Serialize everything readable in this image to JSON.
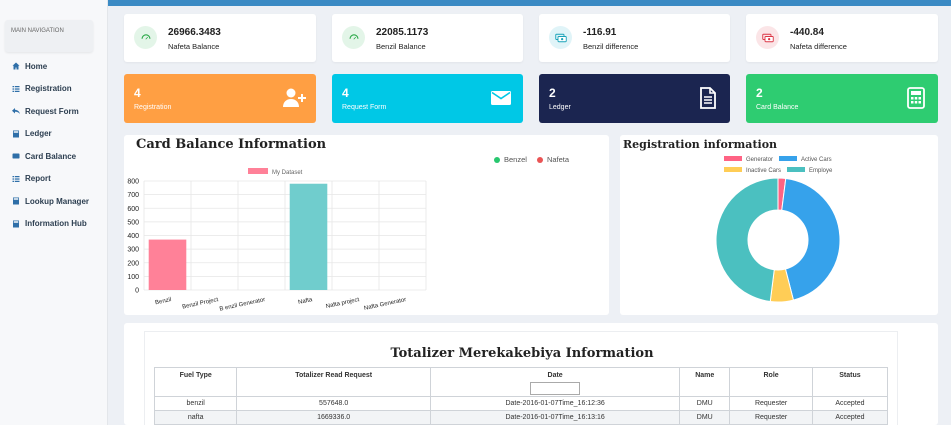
{
  "sidebar": {
    "header": "MAIN NAVIGATION",
    "items": [
      {
        "label": "Home",
        "icon": "home-icon"
      },
      {
        "label": "Registration",
        "icon": "list-icon"
      },
      {
        "label": "Request Form",
        "icon": "reply-icon"
      },
      {
        "label": "Ledger",
        "icon": "book-icon"
      },
      {
        "label": "Card Balance",
        "icon": "card-icon"
      },
      {
        "label": "Report",
        "icon": "list-icon"
      },
      {
        "label": "Lookup Manager",
        "icon": "book-icon"
      },
      {
        "label": "Information Hub",
        "icon": "book-icon"
      }
    ]
  },
  "stats": [
    {
      "value": "26966.3483",
      "label": "Nafeta Balance",
      "icon": "gauge-icon",
      "color": "#28a745"
    },
    {
      "value": "22085.1173",
      "label": "Benzil Balance",
      "icon": "gauge-icon",
      "color": "#28a745"
    },
    {
      "value": "-116.91",
      "label": "Benzil difference",
      "icon": "cash-icon",
      "color": "#17a2b8"
    },
    {
      "value": "-440.84",
      "label": "Nafeta difference",
      "icon": "cash-icon",
      "color": "#dc3545"
    }
  ],
  "cards": [
    {
      "value": "4",
      "label": "Registration",
      "icon": "user-plus-icon",
      "color": "#ff9f43"
    },
    {
      "value": "4",
      "label": "Request Form",
      "icon": "envelope-icon",
      "color": "#00c8e6"
    },
    {
      "value": "2",
      "label": "Ledger",
      "icon": "document-icon",
      "color": "#1b2550"
    },
    {
      "value": "2",
      "label": "Card Balance",
      "icon": "calculator-icon",
      "color": "#2ecc71"
    }
  ],
  "card_balance": {
    "title": "Card Balance Information",
    "legend": [
      {
        "label": "Benzel",
        "color": "#28c76f"
      },
      {
        "label": "Nafeta",
        "color": "#ea5455"
      }
    ]
  },
  "registration": {
    "title": "Registration information"
  },
  "totalizer": {
    "title": "Totalizer Merekakebiya Information",
    "columns": [
      "Fuel Type",
      "Totalizer Read Request",
      "Date",
      "Name",
      "Role",
      "Status"
    ],
    "rows": [
      [
        "benzil",
        "557648.0",
        "Date-2016-01-07Time_16:12:36",
        "DMU",
        "Requester",
        "Accepted"
      ],
      [
        "nafta",
        "1669336.0",
        "Date-2016-01-07Time_16:13:16",
        "DMU",
        "Requester",
        "Accepted"
      ]
    ]
  },
  "chart_data": [
    {
      "type": "bar",
      "series": [
        {
          "name": "My Dataset",
          "values": [
            370,
            0,
            0,
            780,
            0,
            0
          ]
        }
      ],
      "categories": [
        "Benzil",
        "Benzil Project",
        "B enzil Generator",
        "Nafta",
        "Nafta project",
        "Nafta Generator"
      ],
      "colors": [
        "#ff8198",
        "",
        "",
        "#70cdcd",
        "",
        ""
      ],
      "ylim": [
        0,
        800
      ],
      "yticks": [
        0,
        100,
        200,
        300,
        400,
        500,
        600,
        700,
        800
      ],
      "grid": true,
      "legend": "top"
    },
    {
      "type": "pie",
      "donut": true,
      "labels": [
        "Generator",
        "Active Cars",
        "Inactive Cars",
        "Employe"
      ],
      "values": [
        2,
        44,
        6,
        48
      ],
      "colors": [
        "#ff6384",
        "#36a2eb",
        "#ffcd56",
        "#4bc0c0"
      ],
      "legend": "top"
    }
  ]
}
